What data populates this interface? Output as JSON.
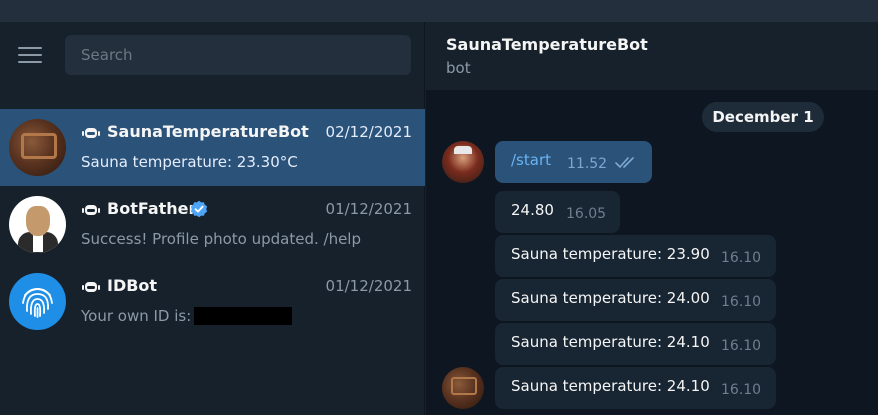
{
  "search": {
    "placeholder": "Search"
  },
  "chats": [
    {
      "name": "SaunaTemperatureBot",
      "date": "02/12/2021",
      "preview": "Sauna temperature: 23.30°C",
      "active": true
    },
    {
      "name": "BotFather",
      "date": "01/12/2021",
      "preview": "Success! Profile photo updated. /help",
      "verified": true
    },
    {
      "name": "IDBot",
      "date": "01/12/2021",
      "preview": "Your own ID is:"
    }
  ],
  "conversation": {
    "title": "SaunaTemperatureBot",
    "subtitle": "bot",
    "date_separator": "December 1",
    "messages": [
      {
        "text": "/start",
        "time": "11.52",
        "outgoing": true,
        "read": true
      },
      {
        "text": "24.80",
        "time": "16.05"
      },
      {
        "text": "Sauna temperature: 23.90",
        "time": "16.10"
      },
      {
        "text": "Sauna temperature: 24.00",
        "time": "16.10"
      },
      {
        "text": "Sauna temperature: 24.10",
        "time": "16.10"
      },
      {
        "text": "Sauna temperature: 24.10",
        "time": "16.10"
      }
    ]
  },
  "colors": {
    "sidebar_bg": "#17212b",
    "chat_bg": "#0e1621",
    "active_chat": "#2b5278",
    "incoming_bubble": "#182533",
    "outgoing_bubble": "#2b5278",
    "verified_badge": "#4ea4f6"
  },
  "icons": [
    "hamburger-menu-icon",
    "bot-icon",
    "verified-badge-icon",
    "double-check-icon",
    "fingerprint-icon"
  ]
}
